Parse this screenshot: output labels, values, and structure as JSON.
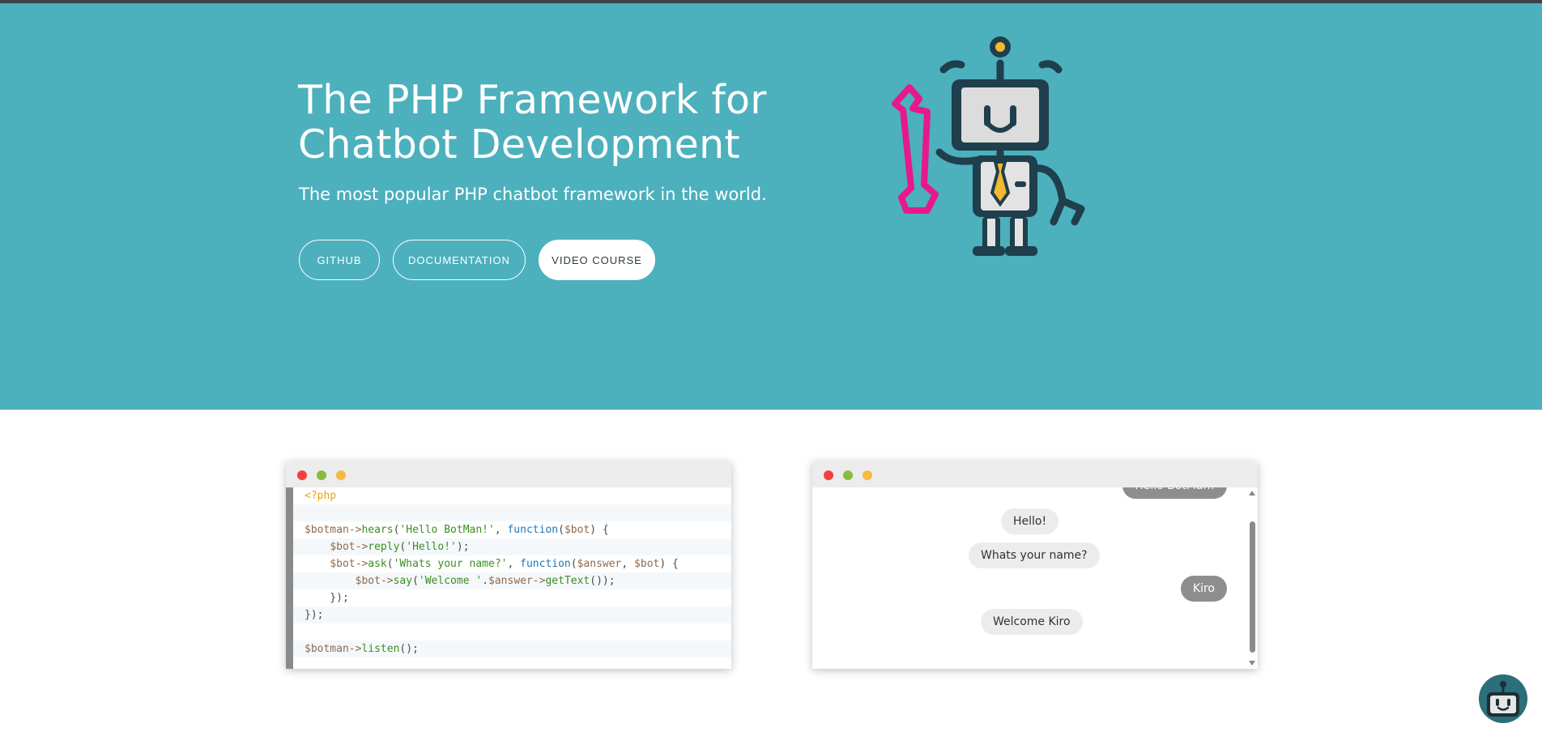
{
  "hero": {
    "title_line1": "The PHP Framework for",
    "title_line2": "Chatbot Development",
    "subtitle": "The most popular PHP chatbot framework in the world.",
    "buttons": {
      "github": "GITHUB",
      "documentation": "DOCUMENTATION",
      "video_course": "VIDEO COURSE"
    },
    "bg_color": "#4cb0bd"
  },
  "code_window": {
    "lines": [
      "<?php",
      "",
      "$botman->hears('Hello BotMan!', function($bot) {",
      "    $bot->reply('Hello!');",
      "    $bot->ask('Whats your name?', function($answer, $bot) {",
      "        $bot->say('Welcome '.$answer->getText());",
      "    });",
      "});",
      "",
      "$botman->listen();"
    ]
  },
  "chat_window": {
    "messages": [
      {
        "from": "user",
        "text": "Hello BotMan!"
      },
      {
        "from": "bot",
        "text": "Hello!"
      },
      {
        "from": "bot",
        "text": "Whats your name?"
      },
      {
        "from": "user",
        "text": "Kiro"
      },
      {
        "from": "bot",
        "text": "Welcome Kiro"
      }
    ]
  },
  "colors": {
    "accent": "#4cb0bd",
    "robot_dark": "#1f3f4c",
    "wrench": "#e6198c",
    "tie": "#f3b930"
  },
  "icons": {
    "robot": "robot-mascot-icon",
    "chat_widget": "chat-widget-robot-icon"
  }
}
